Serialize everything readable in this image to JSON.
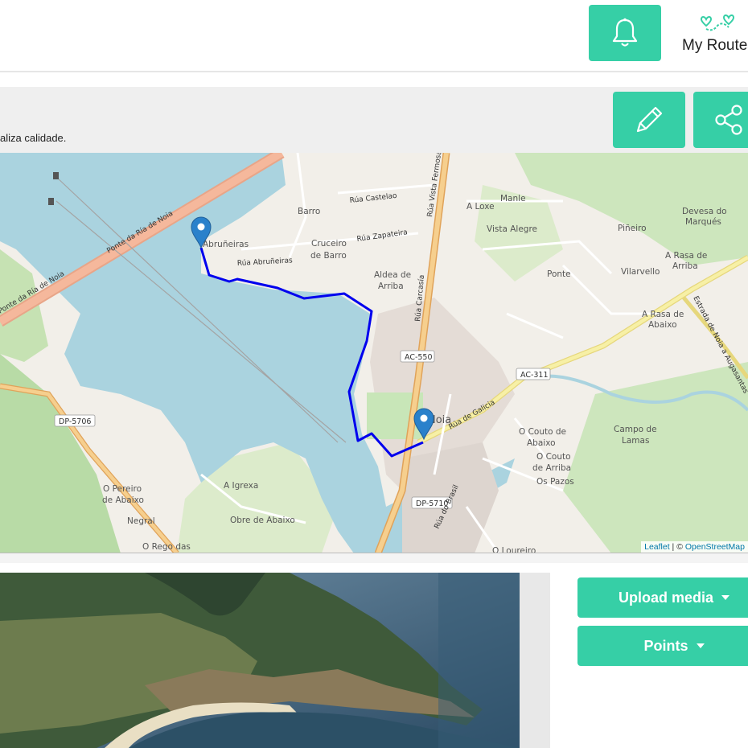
{
  "header": {
    "notifications_icon": "bell-icon",
    "my_routes_icon": "route-icon",
    "my_routes_label": "My Routes"
  },
  "route": {
    "description": "aliza calidade.",
    "edit_icon": "pencil-icon",
    "share_icon": "share-icon"
  },
  "map": {
    "labels": {
      "barro": "Barro",
      "rua_castelao": "Rúa Castelao",
      "rua_vista_fermosa": "Rúa Vista Fermosa",
      "manle": "Manle",
      "a_loxe": "A Loxe",
      "abrunheiras": "Abruñeiras",
      "cruceiro": "Cruceiro",
      "de_barro": "de Barro",
      "rua_zapateira": "Rúa Zapateira",
      "vista_alegre": "Vista Alegre",
      "pineiro": "Piñeiro",
      "devesa": "Devesa do",
      "marques": "Marqués",
      "ponte_ria_noia_1": "Ponte da Ría de Noia",
      "ponte_ria_noia_2": "Ponte da Ría de Noia",
      "rua_abrunheiras": "Rúa Abruñeiras",
      "aldea": "Aldea de",
      "arriba": "Arriba",
      "ponte": "Ponte",
      "a_rasa_arriba_1": "A Rasa de",
      "a_rasa_arriba_2": "Arriba",
      "vilarvello": "Vilarvello",
      "a_rasa_abaixo_1": "A Rasa de",
      "a_rasa_abaixo_2": "Abaixo",
      "rua_carcasia": "Rúa Carcasía",
      "estrada_noia": "Estrada de Noia a Augasantas",
      "ac550": "AC-550",
      "ac311": "AC-311",
      "dp5706": "DP-5706",
      "dp5710": "DP-5710",
      "noia": "Noia",
      "rua_galicia": "Rúa de Galicia",
      "o_couto_abaixo_1": "O Couto de",
      "o_couto_abaixo_2": "Abaixo",
      "o_couto_arriba_1": "O Couto",
      "o_couto_arriba_2": "de Arriba",
      "os_pazos": "Os Pazos",
      "campo_1": "Campo de",
      "campo_2": "Lamas",
      "o_pereiro_1": "O Pereiro",
      "o_pereiro_2": "de Abaixo",
      "a_igrexa": "A Igrexa",
      "negral": "Negral",
      "obre": "Obre de Abaixo",
      "o_rego": "O Rego das",
      "o_loureiro": "O Loureiro",
      "rua_brasil": "Rúa do Brasil"
    },
    "attribution_leaflet": "Leaflet",
    "attribution_sep": " | © ",
    "attribution_osm": "OpenStreetMap",
    "route_color": "#0000ee",
    "marker_color": "#2a81cb"
  },
  "actions": {
    "upload_media": "Upload media",
    "points": "Points"
  },
  "colors": {
    "accent": "#36cfa6",
    "water": "#aad3df",
    "land": "#f2efe9"
  }
}
